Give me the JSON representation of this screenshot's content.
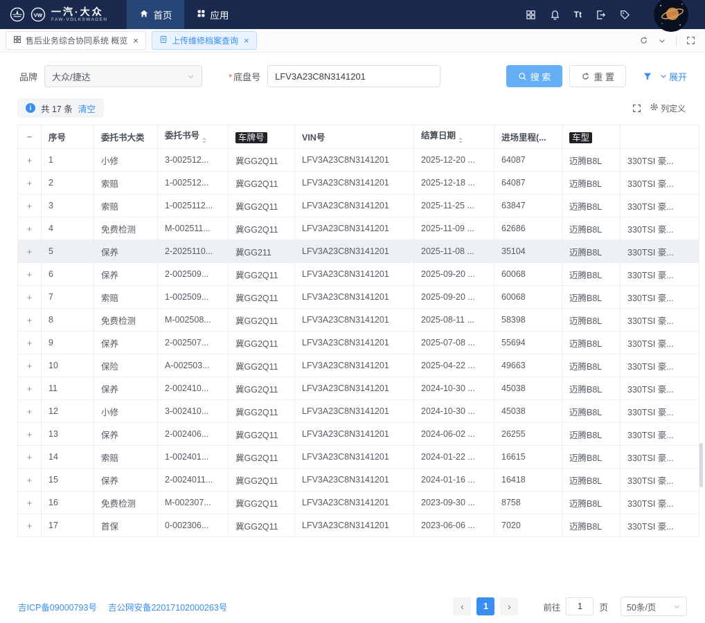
{
  "navbar": {
    "brand_cn": "一汽·大众",
    "brand_en": "FAW-VOLKSWAGEN",
    "home": "首页",
    "apps": "应用"
  },
  "tabs": {
    "overview": "售后业务综合协同系统 概览",
    "archive_query": "上传维修档案查询"
  },
  "filters": {
    "brand_label": "品牌",
    "brand_value": "大众/捷达",
    "required_mark": "*",
    "chassis_label": "底盘号",
    "chassis_value": "LFV3A23C8N3141201",
    "search_label": "搜 索",
    "reset_label": "重 置",
    "expand_label": "展开"
  },
  "summary": {
    "count_text": "共 17 条",
    "clear_label": "清空",
    "column_def_label": "列定义"
  },
  "table": {
    "highlight_index": 4,
    "headers": [
      {
        "label": "−",
        "name": "column-header-collapse"
      },
      {
        "label": "序号",
        "name": "column-header-seq"
      },
      {
        "label": "委托书大类",
        "name": "column-header-category"
      },
      {
        "label": "委托书号",
        "name": "column-header-order-no",
        "sortable": true
      },
      {
        "label": "车牌号",
        "name": "column-header-plate",
        "redacted": true
      },
      {
        "label": "VIN号",
        "name": "column-header-vin"
      },
      {
        "label": "结算日期",
        "name": "column-header-date",
        "sortable": true
      },
      {
        "label": "进场里程(...",
        "name": "column-header-mileage"
      },
      {
        "label": "车型",
        "name": "column-header-model",
        "redacted": true
      },
      {
        "label": "",
        "name": "column-header-trim"
      }
    ],
    "rows": [
      {
        "seq": "1",
        "category": "小修",
        "order_no": "3-002512...",
        "plate": "冀GG2Q11",
        "vin": "LFV3A23C8N3141201",
        "date": "2025-12-20 ...",
        "mileage": "64087",
        "model": "迈腾B8L",
        "trim": "330TSI 豪..."
      },
      {
        "seq": "2",
        "category": "索赔",
        "order_no": "1-002512...",
        "plate": "冀GG2Q11",
        "vin": "LFV3A23C8N3141201",
        "date": "2025-12-18 ...",
        "mileage": "64087",
        "model": "迈腾B8L",
        "trim": "330TSI 豪..."
      },
      {
        "seq": "3",
        "category": "索赔",
        "order_no": "1-0025112...",
        "plate": "冀GG2Q11",
        "vin": "LFV3A23C8N3141201",
        "date": "2025-11-25 ...",
        "mileage": "63847",
        "model": "迈腾B8L",
        "trim": "330TSI 豪..."
      },
      {
        "seq": "4",
        "category": "免费检测",
        "order_no": "M-002511...",
        "plate": "冀GG2Q11",
        "vin": "LFV3A23C8N3141201",
        "date": "2025-11-09 ...",
        "mileage": "62686",
        "model": "迈腾B8L",
        "trim": "330TSI 豪..."
      },
      {
        "seq": "5",
        "category": "保养",
        "order_no": "2-2025110...",
        "plate": "冀GG211",
        "vin": "LFV3A23C8N3141201",
        "date": "2025-11-08 ...",
        "mileage": "35104",
        "model": "迈腾B8L",
        "trim": "330TSI 豪..."
      },
      {
        "seq": "6",
        "category": "保养",
        "order_no": "2-002509...",
        "plate": "冀GG2Q11",
        "vin": "LFV3A23C8N3141201",
        "date": "2025-09-20 ...",
        "mileage": "60068",
        "model": "迈腾B8L",
        "trim": "330TSI 豪..."
      },
      {
        "seq": "7",
        "category": "索赔",
        "order_no": "1-002509...",
        "plate": "冀GG2Q11",
        "vin": "LFV3A23C8N3141201",
        "date": "2025-09-20 ...",
        "mileage": "60068",
        "model": "迈腾B8L",
        "trim": "330TSI 豪..."
      },
      {
        "seq": "8",
        "category": "免费检测",
        "order_no": "M-002508...",
        "plate": "冀GG2Q11",
        "vin": "LFV3A23C8N3141201",
        "date": "2025-08-11 ...",
        "mileage": "58398",
        "model": "迈腾B8L",
        "trim": "330TSI 豪..."
      },
      {
        "seq": "9",
        "category": "保养",
        "order_no": "2-002507...",
        "plate": "冀GG2Q11",
        "vin": "LFV3A23C8N3141201",
        "date": "2025-07-08 ...",
        "mileage": "55694",
        "model": "迈腾B8L",
        "trim": "330TSI 豪..."
      },
      {
        "seq": "10",
        "category": "保险",
        "order_no": "A-002503...",
        "plate": "冀GG2Q11",
        "vin": "LFV3A23C8N3141201",
        "date": "2025-04-22 ...",
        "mileage": "49663",
        "model": "迈腾B8L",
        "trim": "330TSI 豪..."
      },
      {
        "seq": "11",
        "category": "保养",
        "order_no": "2-002410...",
        "plate": "冀GG2Q11",
        "vin": "LFV3A23C8N3141201",
        "date": "2024-10-30 ...",
        "mileage": "45038",
        "model": "迈腾B8L",
        "trim": "330TSI 豪..."
      },
      {
        "seq": "12",
        "category": "小修",
        "order_no": "3-002410...",
        "plate": "冀GG2Q11",
        "vin": "LFV3A23C8N3141201",
        "date": "2024-10-30 ...",
        "mileage": "45038",
        "model": "迈腾B8L",
        "trim": "330TSI 豪..."
      },
      {
        "seq": "13",
        "category": "保养",
        "order_no": "2-002406...",
        "plate": "冀GG2Q11",
        "vin": "LFV3A23C8N3141201",
        "date": "2024-06-02 ...",
        "mileage": "26255",
        "model": "迈腾B8L",
        "trim": "330TSI 豪..."
      },
      {
        "seq": "14",
        "category": "索赔",
        "order_no": "1-002401...",
        "plate": "冀GG2Q11",
        "vin": "LFV3A23C8N3141201",
        "date": "2024-01-22 ...",
        "mileage": "16615",
        "model": "迈腾B8L",
        "trim": "330TSI 豪..."
      },
      {
        "seq": "15",
        "category": "保养",
        "order_no": "2-0024011...",
        "plate": "冀GG2Q11",
        "vin": "LFV3A23C8N3141201",
        "date": "2024-01-16 ...",
        "mileage": "16418",
        "model": "迈腾B8L",
        "trim": "330TSI 豪..."
      },
      {
        "seq": "16",
        "category": "免费检测",
        "order_no": "M-002307...",
        "plate": "冀GG2Q11",
        "vin": "LFV3A23C8N3141201",
        "date": "2023-09-30 ...",
        "mileage": "8758",
        "model": "迈腾B8L",
        "trim": "330TSI 豪..."
      },
      {
        "seq": "17",
        "category": "首保",
        "order_no": "0-002306...",
        "plate": "冀GG2Q11",
        "vin": "LFV3A23C8N3141201",
        "date": "2023-06-06 ...",
        "mileage": "7020",
        "model": "迈腾B8L",
        "trim": "330TSI 豪..."
      }
    ]
  },
  "footer": {
    "icp": "吉ICP备09000793号",
    "security": "吉公网安备22017102000263号",
    "prev": "‹",
    "page": "1",
    "next": "›",
    "goto_label": "前往",
    "goto_value": "1",
    "page_unit": "页",
    "page_size": "50条/页"
  },
  "colors": {
    "navbar_bg": "#1a2a4f",
    "primary": "#3a8ef0",
    "search_button": "#63aef5",
    "tab_active_bg": "#e9f3ff"
  }
}
